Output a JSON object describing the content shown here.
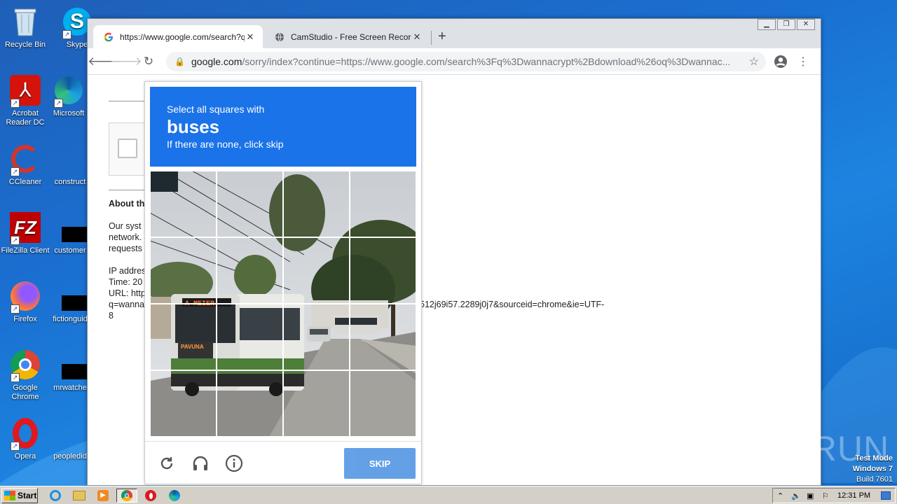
{
  "desktop": {
    "icons": [
      {
        "label": "Recycle Bin"
      },
      {
        "label": "Skype"
      },
      {
        "label": "Acrobat Reader DC"
      },
      {
        "label": "Microsoft"
      },
      {
        "label": "CCleaner"
      },
      {
        "label": "construct"
      },
      {
        "label": "FileZilla Client"
      },
      {
        "label": "customer"
      },
      {
        "label": "Firefox"
      },
      {
        "label": "fictionguid"
      },
      {
        "label": "Google Chrome"
      },
      {
        "label": "mrwatche"
      },
      {
        "label": "Opera"
      },
      {
        "label": "peopledid"
      }
    ]
  },
  "browser": {
    "tabs": [
      {
        "title": "https://www.google.com/search?q=",
        "icon": "google-icon",
        "active": true
      },
      {
        "title": "CamStudio - Free Screen Recording",
        "icon": "globe-icon",
        "active": false
      }
    ],
    "new_tab_label": "+",
    "address": {
      "host": "google.com",
      "path": "/sorry/index?continue=https://www.google.com/search%3Fq%3Dwannacrypt%2Bdownload%26oq%3Dwannac..."
    },
    "page": {
      "about_heading": "About th",
      "para1": [
        "Our syst",
        "network.",
        "requests"
      ],
      "para2": [
        "IP addres",
        "Time: 20",
        "URL: http",
        "q=wanna",
        "8"
      ],
      "url_tail": "512j69i57.2289j0j7&sourceid=chrome&ie=UTF-"
    }
  },
  "captcha": {
    "line1": "Select all squares with",
    "target": "buses",
    "line3": "If there are none, click skip",
    "skip_label": "SKIP",
    "bus_sign": "A MEIER",
    "bus_front": "PAVUNA",
    "colors": {
      "header": "#1a73e8",
      "skip": "#4a90e2"
    }
  },
  "watermark": {
    "text": "ANY RUN"
  },
  "test_mode": {
    "line1": "Test Mode",
    "line2": "Windows 7",
    "line3": "Build 7601"
  },
  "taskbar": {
    "start_label": "Start",
    "clock": "12:31 PM"
  }
}
